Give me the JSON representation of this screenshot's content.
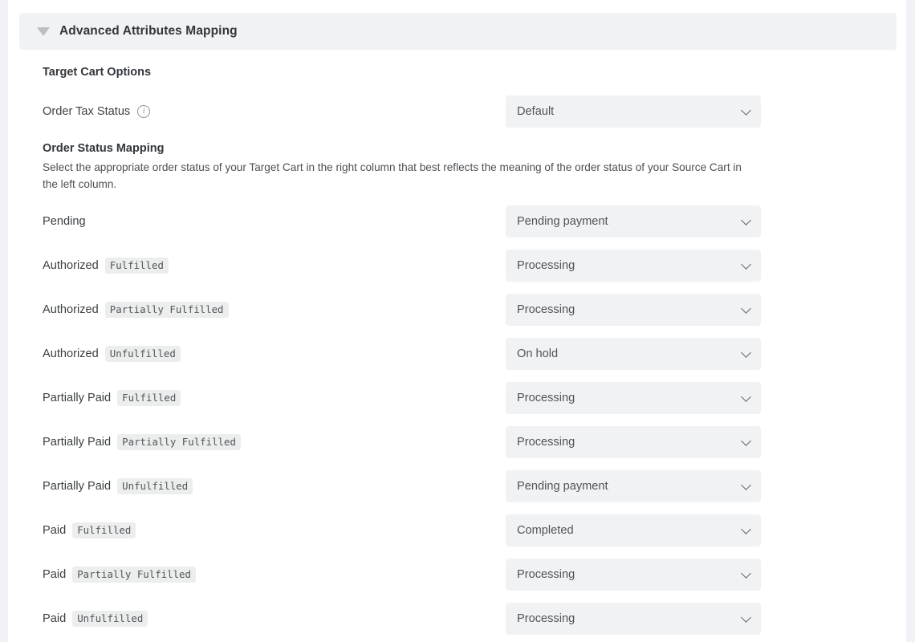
{
  "section": {
    "title": "Advanced Attributes Mapping",
    "caret_icon": "triangle-down-icon",
    "expanded": true
  },
  "target_cart_options": {
    "title": "Target Cart Options",
    "order_tax_status": {
      "label": "Order Tax Status",
      "info_icon": "info-circle-icon",
      "value": "Default"
    }
  },
  "order_status_mapping": {
    "title": "Order Status Mapping",
    "description": "Select the appropriate order status of your Target Cart in the right column that best reflects the meaning of the order status of your Source Cart in the left column.",
    "rows": [
      {
        "source_label": "Pending",
        "source_badge": "",
        "target_value": "Pending payment"
      },
      {
        "source_label": "Authorized",
        "source_badge": "Fulfilled",
        "target_value": "Processing"
      },
      {
        "source_label": "Authorized",
        "source_badge": "Partially Fulfilled",
        "target_value": "Processing"
      },
      {
        "source_label": "Authorized",
        "source_badge": "Unfulfilled",
        "target_value": "On hold"
      },
      {
        "source_label": "Partially Paid",
        "source_badge": "Fulfilled",
        "target_value": "Processing"
      },
      {
        "source_label": "Partially Paid",
        "source_badge": "Partially Fulfilled",
        "target_value": "Processing"
      },
      {
        "source_label": "Partially Paid",
        "source_badge": "Unfulfilled",
        "target_value": "Pending payment"
      },
      {
        "source_label": "Paid",
        "source_badge": "Fulfilled",
        "target_value": "Completed"
      },
      {
        "source_label": "Paid",
        "source_badge": "Partially Fulfilled",
        "target_value": "Processing"
      },
      {
        "source_label": "Paid",
        "source_badge": "Unfulfilled",
        "target_value": "Processing"
      }
    ]
  },
  "colors": {
    "page_background": "#f1f2f6",
    "card_background": "#ffffff",
    "field_background": "#f1f2f4",
    "badge_background": "#eceded",
    "heading_text": "#32373c",
    "body_text": "#4b5055"
  }
}
